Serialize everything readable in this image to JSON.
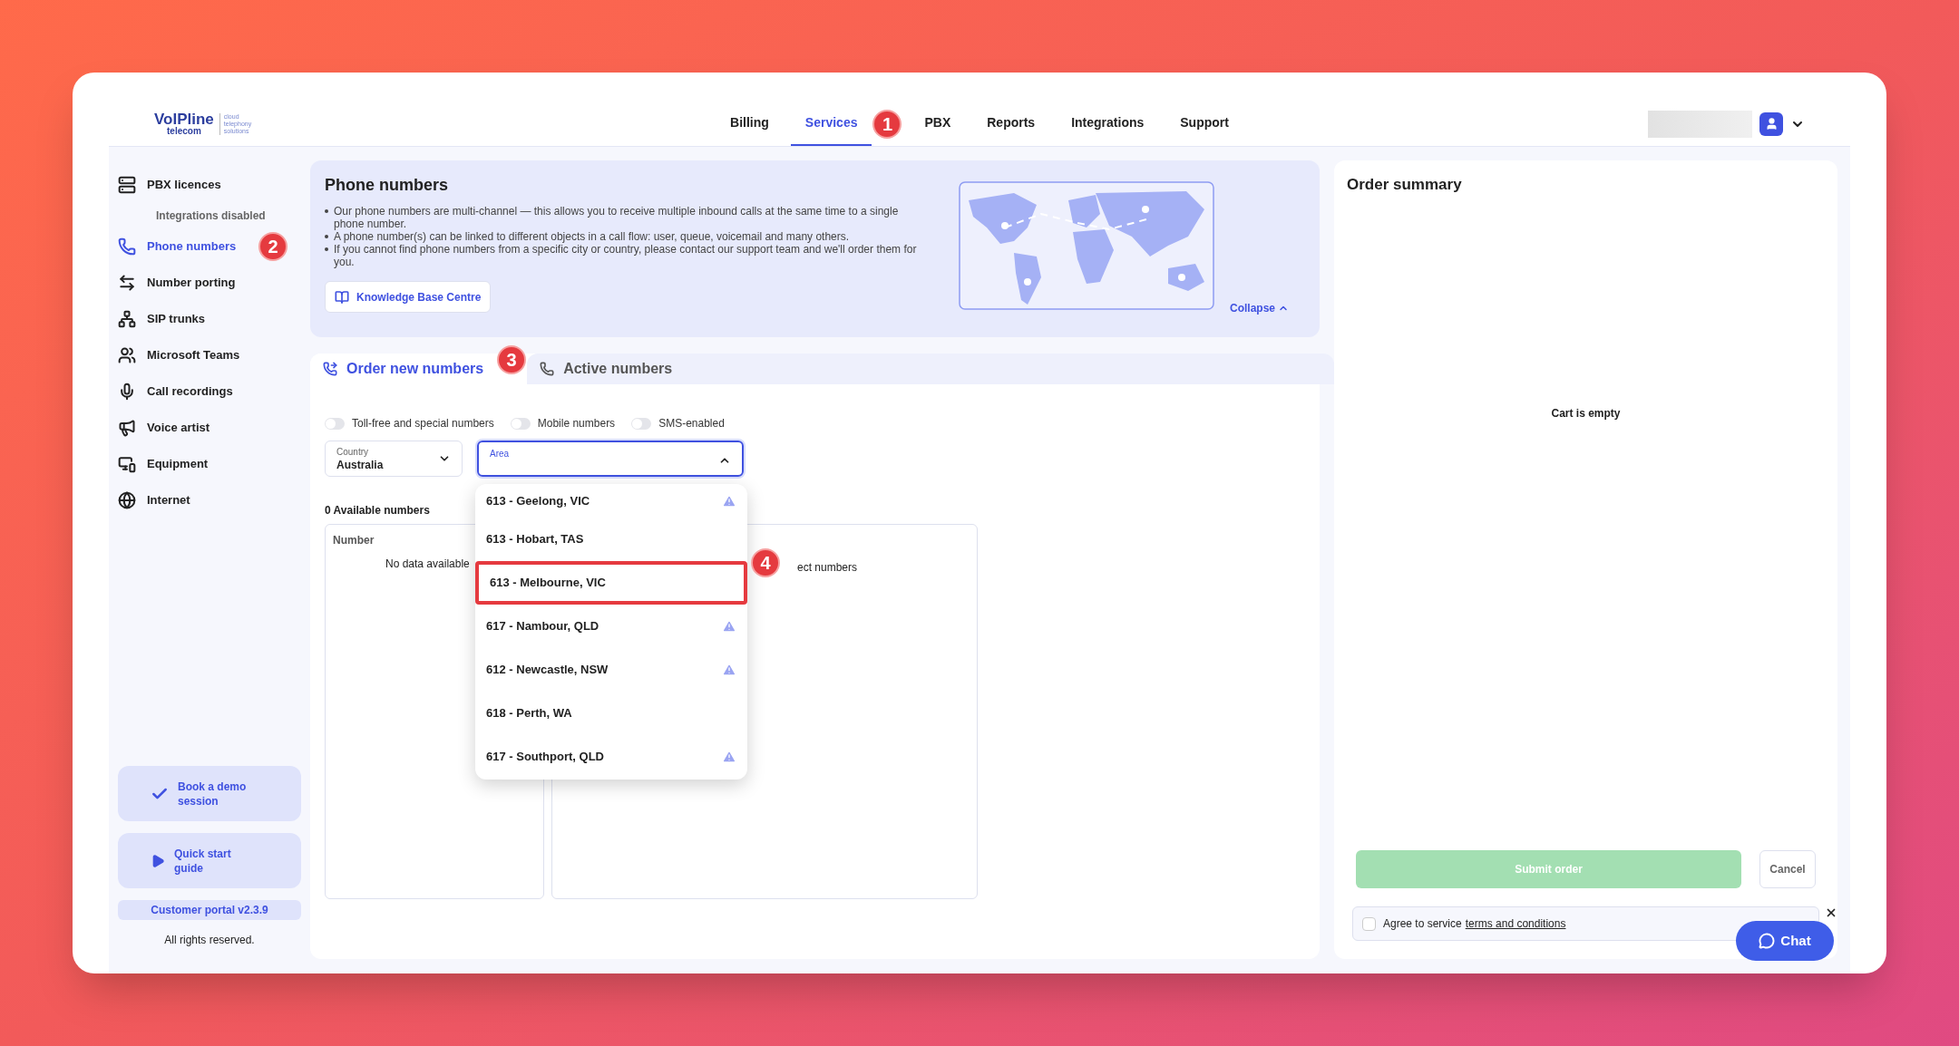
{
  "brand": {
    "name": "VoIPline",
    "sub": "telecom",
    "tagline": [
      "cloud",
      "telephony",
      "solutions"
    ]
  },
  "nav": [
    {
      "label": "Billing",
      "selected": false
    },
    {
      "label": "Services",
      "selected": true,
      "marker": "1"
    },
    {
      "label": "PBX",
      "selected": false
    },
    {
      "label": "Reports",
      "selected": false
    },
    {
      "label": "Integrations",
      "selected": false
    },
    {
      "label": "Support",
      "selected": false
    }
  ],
  "sidebar": {
    "items": [
      {
        "kind": "item",
        "label": "PBX licences",
        "selected": false
      },
      {
        "kind": "note",
        "label": "Integrations disabled"
      },
      {
        "kind": "item",
        "label": "Phone numbers",
        "selected": true,
        "marker": "2"
      },
      {
        "kind": "item",
        "label": "Number porting",
        "selected": false
      },
      {
        "kind": "item",
        "label": "SIP trunks",
        "selected": false
      },
      {
        "kind": "item",
        "label": "Microsoft Teams",
        "selected": false
      },
      {
        "kind": "item",
        "label": "Call recordings",
        "selected": false
      },
      {
        "kind": "item",
        "label": "Voice artist",
        "selected": false
      },
      {
        "kind": "item",
        "label": "Equipment",
        "selected": false
      },
      {
        "kind": "item",
        "label": "Internet",
        "selected": false
      }
    ],
    "cards": [
      "Book a demo session",
      "Quick start guide"
    ],
    "version": "Customer portal v2.3.9",
    "rights": "All rights reserved."
  },
  "info": {
    "title": "Phone numbers",
    "bullets": [
      "Our phone numbers are multi-channel — this allows you to receive multiple inbound calls at the same time to a single phone number.",
      "A phone number(s) can be linked to different objects in a call flow: user, queue, voicemail and many others.",
      "If you cannot find phone numbers from a specific city or country, please contact our support team and we'll order them for you."
    ],
    "button": "Knowledge Base Centre",
    "collapse": "Collapse"
  },
  "tabs": [
    {
      "label": "Order new numbers",
      "selected": true,
      "marker": "3"
    },
    {
      "label": "Active numbers",
      "selected": false
    }
  ],
  "filters": [
    {
      "label": "Toll-free and special numbers",
      "on": false
    },
    {
      "label": "Mobile numbers",
      "on": false
    },
    {
      "label": "SMS-enabled",
      "on": false
    }
  ],
  "country": {
    "label": "Country",
    "value": "Australia"
  },
  "area": {
    "label": "Area",
    "expanded": true,
    "options": [
      {
        "label": "613 - Geelong, VIC",
        "warning": true,
        "highlighted": false
      },
      {
        "label": "613 - Hobart, TAS",
        "warning": false,
        "highlighted": false
      },
      {
        "label": "613 - Melbourne, VIC",
        "warning": false,
        "highlighted": true,
        "marker": "4"
      },
      {
        "label": "617 - Nambour, QLD",
        "warning": true,
        "highlighted": false
      },
      {
        "label": "612 - Newcastle, NSW",
        "warning": true,
        "highlighted": false
      },
      {
        "label": "618 - Perth, WA",
        "warning": false,
        "highlighted": false
      },
      {
        "label": "617 - Southport, QLD",
        "warning": true,
        "highlighted": false
      }
    ]
  },
  "available": "0 Available numbers",
  "table": {
    "column": "Number",
    "empty": "No data available",
    "side_text": "ect numbers"
  },
  "summary": {
    "title": "Order summary",
    "empty": "Cart is empty",
    "submit": {
      "label": "Submit order",
      "disabled": true
    },
    "cancel": "Cancel",
    "agree": {
      "text": "Agree to service",
      "link": "terms and conditions",
      "checked": false
    }
  },
  "chat": "Chat"
}
